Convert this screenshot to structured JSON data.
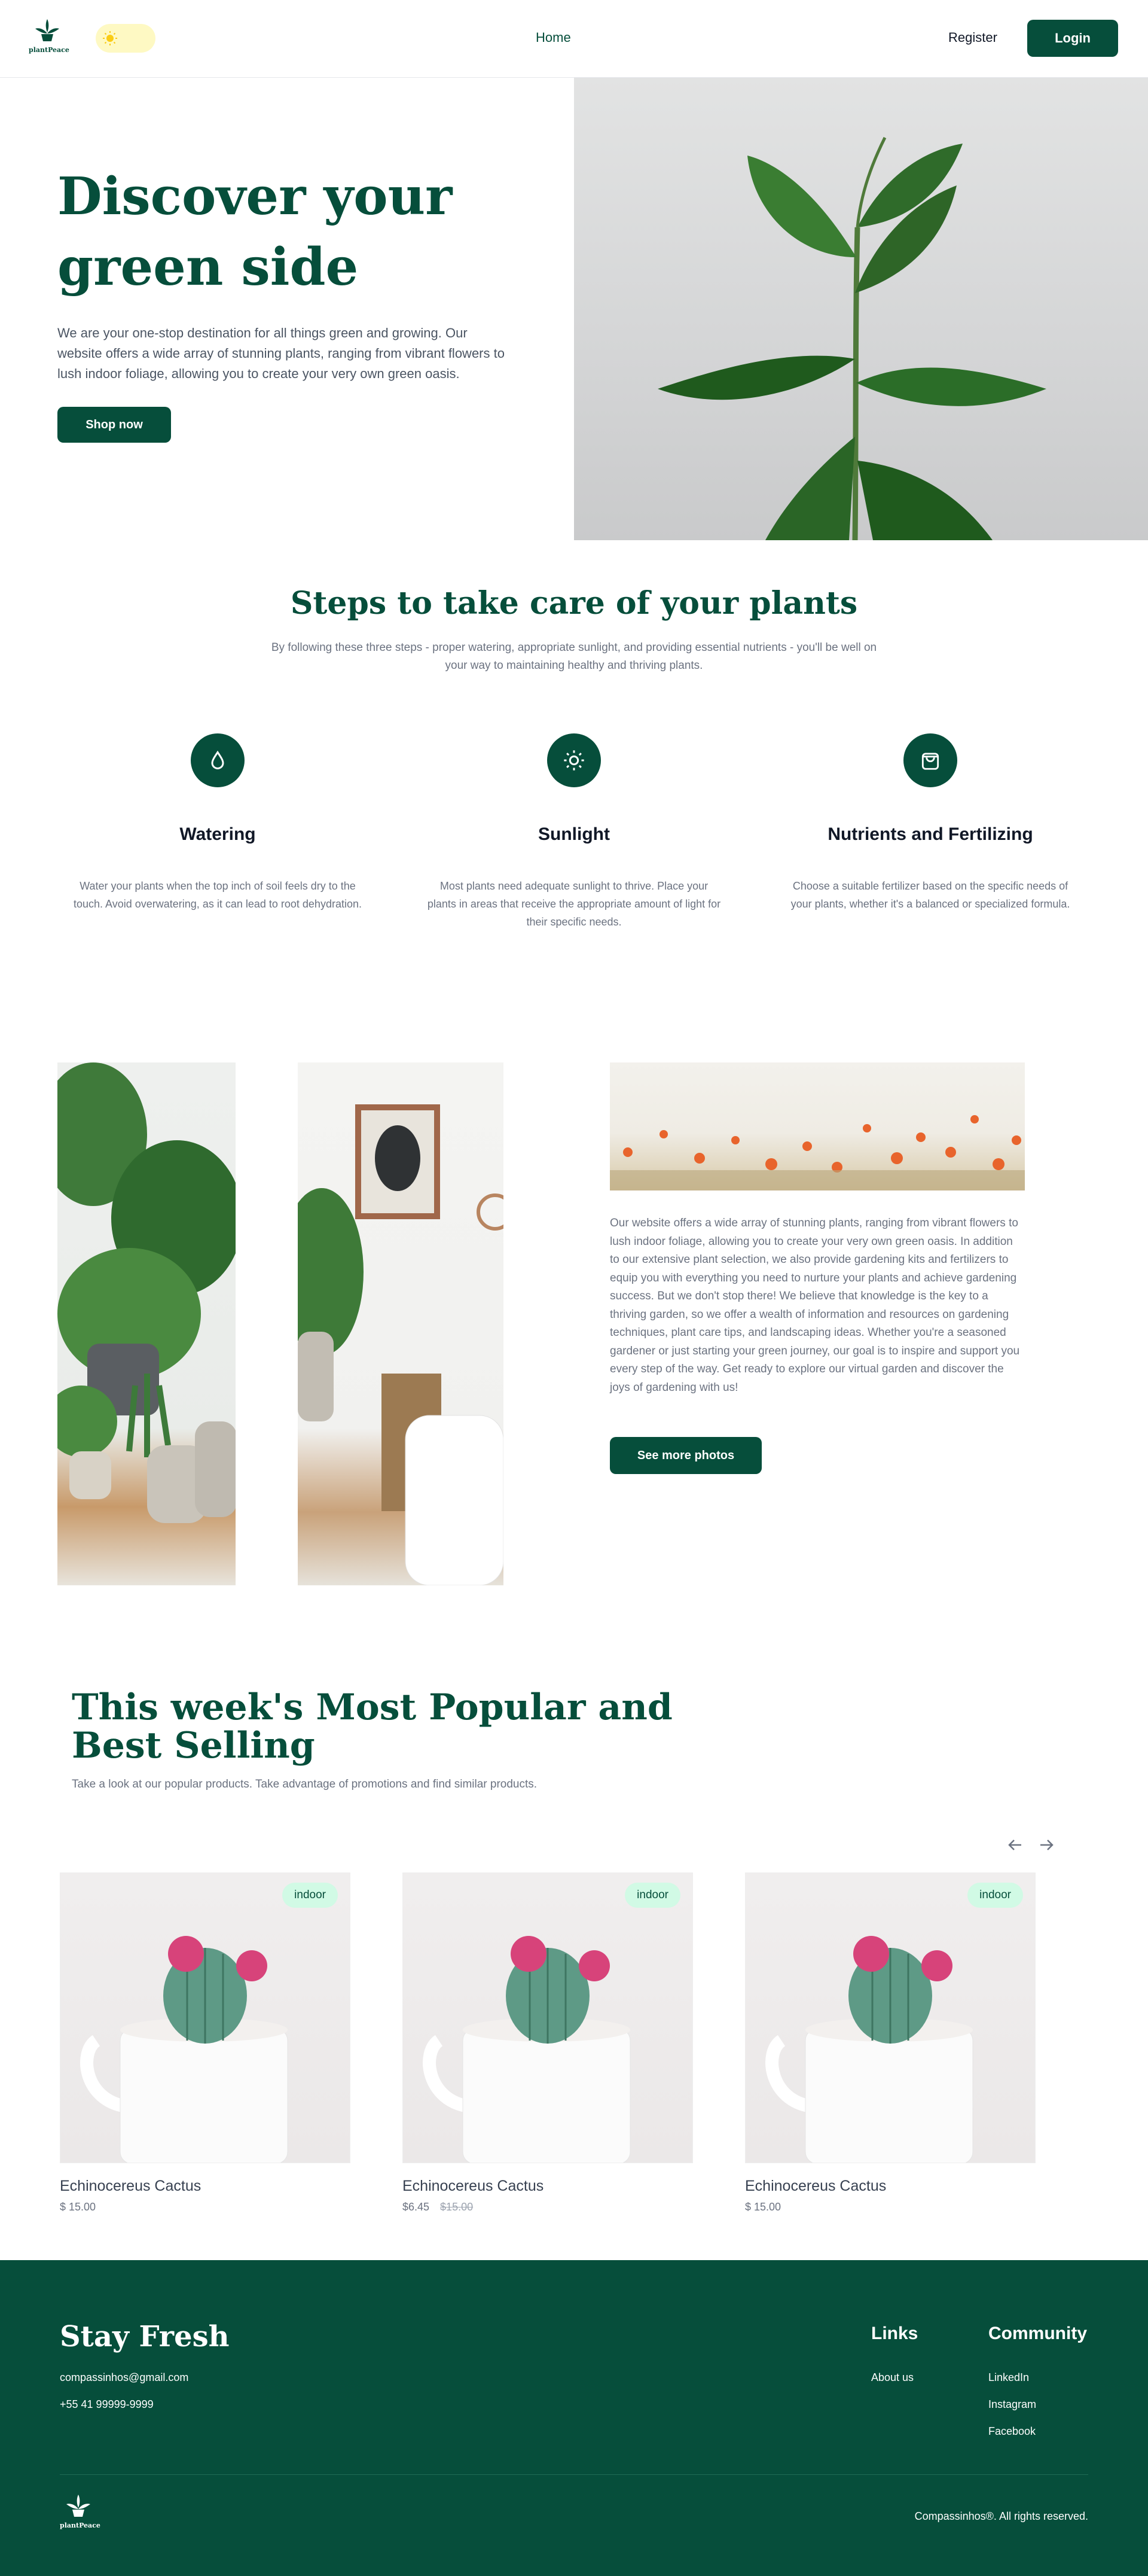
{
  "header": {
    "logo_text": "plantPeace",
    "nav_home": "Home",
    "register": "Register",
    "login": "Login"
  },
  "hero": {
    "title": "Discover your green side",
    "text": "We are your one-stop destination for all things green and growing. Our website offers a wide array of stunning plants, ranging from vibrant flowers to lush indoor foliage, allowing you to create your very own green oasis.",
    "cta": "Shop now"
  },
  "steps": {
    "title": "Steps to take care of your plants",
    "subtitle": "By following these three steps - proper watering, appropriate sunlight, and providing essential nutrients - you'll be well on your way to maintaining healthy and thriving plants.",
    "items": [
      {
        "icon": "water-drop-icon",
        "title": "Watering",
        "text": "Water your plants when the top inch of soil feels dry to the touch. Avoid overwatering, as it can lead to root dehydration."
      },
      {
        "icon": "sun-icon",
        "title": "Sunlight",
        "text": "Most plants need adequate sunlight to thrive. Place your plants in areas that receive the appropriate amount of light for their specific needs."
      },
      {
        "icon": "shopping-bag-icon",
        "title": "Nutrients and Fertilizing",
        "text": "Choose a suitable fertilizer based on the specific needs of your plants, whether it's a balanced or specialized formula."
      }
    ]
  },
  "gallery": {
    "text": "Our website offers a wide array of stunning plants, ranging from vibrant flowers to lush indoor foliage, allowing you to create your very own green oasis. In addition to our extensive plant selection, we also provide gardening kits and fertilizers to equip you with everything you need to nurture your plants and achieve gardening success. But we don't stop there! We believe that knowledge is the key to a thriving garden, so we offer a wealth of information and resources on gardening techniques, plant care tips, and landscaping ideas. Whether you're a seasoned gardener or just starting your green journey, our goal is to inspire and support you every step of the way. Get ready to explore our virtual garden and discover the joys of gardening with us!",
    "cta": "See more photos"
  },
  "popular": {
    "title": "This week's Most Popular and Best Selling",
    "subtitle": "Take a look at our popular products. Take advantage of promotions and find similar products.",
    "products": [
      {
        "badge": "indoor",
        "name": "Echinocereus Cactus",
        "price": "$ 15.00",
        "old_price": ""
      },
      {
        "badge": "indoor",
        "name": "Echinocereus Cactus",
        "price": "$6.45",
        "old_price": "$15.00"
      },
      {
        "badge": "indoor",
        "name": "Echinocereus Cactus",
        "price": "$ 15.00",
        "old_price": ""
      }
    ]
  },
  "footer": {
    "title": "Stay Fresh",
    "email": "compassinhos@gmail.com",
    "phone": "+55 41 99999-9999",
    "links_title": "Links",
    "links": [
      "About us"
    ],
    "community_title": "Community",
    "community": [
      "LinkedIn",
      "Instagram",
      "Facebook"
    ],
    "logo_text": "plantPeace",
    "copyright": "Compassinhos®. All rights reserved."
  },
  "colors": {
    "brand": "#064e3b",
    "badge_bg": "#d1fae5",
    "toggle_bg": "#fef9c3"
  }
}
